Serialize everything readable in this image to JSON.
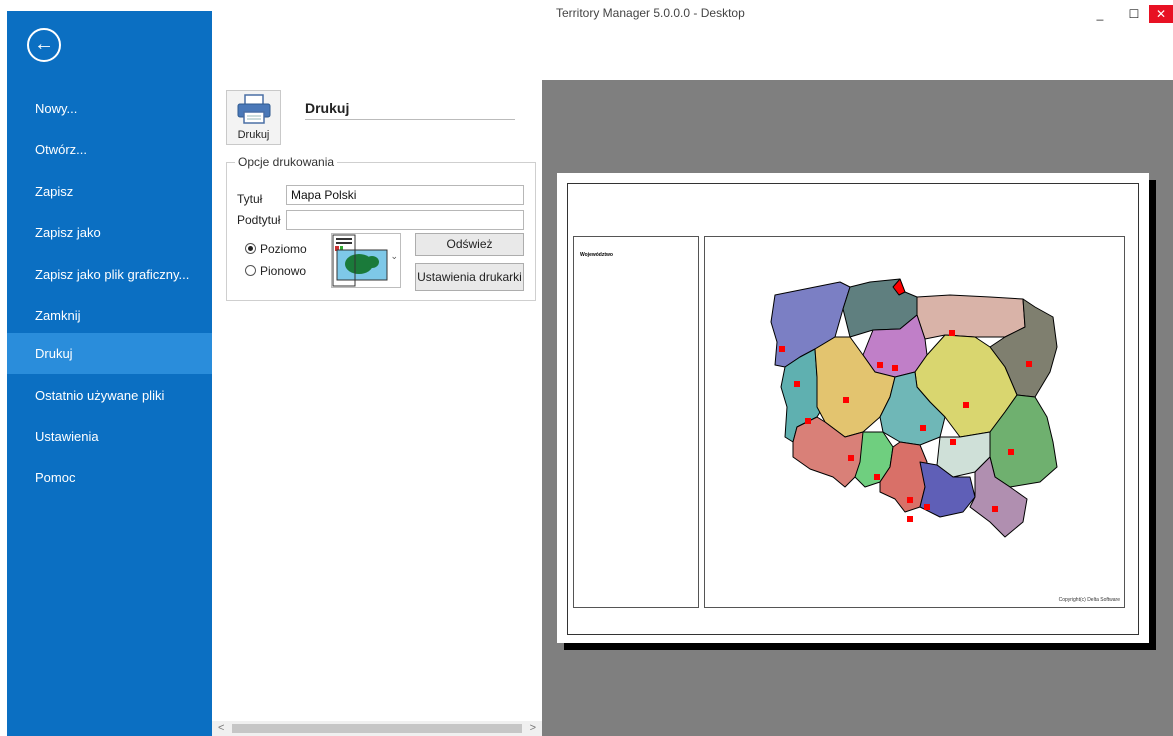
{
  "window": {
    "title": "Territory Manager 5.0.0.0 - Desktop",
    "minimize": "_",
    "maximize": "☐",
    "close": "✕"
  },
  "sidebar": {
    "back_icon": "arrow-left-circle-icon",
    "back_glyph": "←",
    "items": [
      {
        "label": "Nowy..."
      },
      {
        "label": "Otwórz..."
      },
      {
        "label": "Zapisz"
      },
      {
        "label": "Zapisz jako"
      },
      {
        "label": "Zapisz jako plik graficzny..."
      },
      {
        "label": "Zamknij"
      },
      {
        "label": "Drukuj",
        "active": true
      },
      {
        "label": "Ostatnio używane pliki"
      },
      {
        "label": "Ustawienia"
      },
      {
        "label": "Pomoc"
      }
    ]
  },
  "print": {
    "button_label": "Drukuj",
    "section_title": "Drukuj",
    "options_group": "Opcje drukowania",
    "title_label": "Tytuł",
    "title_value": "Mapa Polski",
    "subtitle_label": "Podtytuł",
    "subtitle_value": "",
    "landscape_label": "Poziomo",
    "portrait_label": "Pionowo",
    "selected_orientation": "Poziomo",
    "refresh_label": "Odśwież",
    "printer_settings_label": "Ustawienia drukarki"
  },
  "scrollbar": {
    "left": "<",
    "right": ">"
  },
  "preview": {
    "legend_title": "Województwo",
    "copyright": "Copyright(c) Delta Software",
    "colors": {
      "zachodniopomorskie": "#7b7fc4",
      "pomorskie": "#5f7f7f",
      "warminsko_mazurskie": "#d9b3a8",
      "podlaskie": "#7f7f6f",
      "kujawsko_pomorskie": "#c07fc8",
      "lubuskie": "#5fb0b0",
      "wielkopolskie": "#e3c46f",
      "mazowieckie": "#d9d66f",
      "lodzkie": "#6fb7b7",
      "lubelskie": "#6fb06f",
      "dolnoslaskie": "#d98078",
      "opolskie": "#6fcf7f",
      "swietokrzyskie": "#cfe0d8",
      "slaskie": "#d97068",
      "malopolskie": "#5f5fb7",
      "podkarpackie": "#b08fb0",
      "marker": "#ff0000"
    }
  }
}
